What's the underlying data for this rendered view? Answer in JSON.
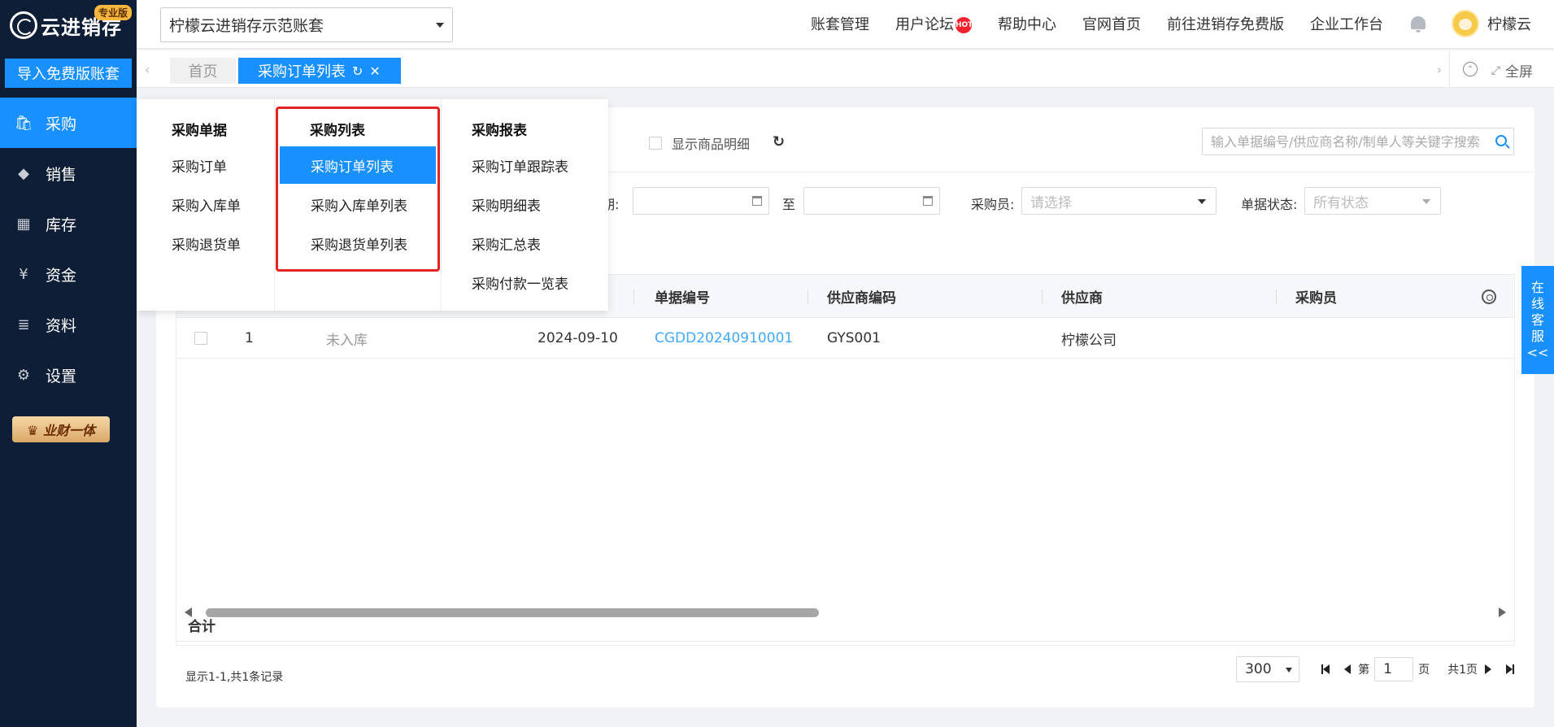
{
  "sidebar": {
    "logo_text": "云进销存",
    "pro_badge": "专业版",
    "import_button": "导入免费版账套",
    "items": [
      {
        "label": "采购",
        "icon": "shopping-bag-icon",
        "glyph": "🛍"
      },
      {
        "label": "销售",
        "icon": "sales-icon",
        "glyph": "◆"
      },
      {
        "label": "库存",
        "icon": "warehouse-icon",
        "glyph": "▦"
      },
      {
        "label": "资金",
        "icon": "yen-icon",
        "glyph": "¥"
      },
      {
        "label": "资料",
        "icon": "document-icon",
        "glyph": "≣"
      },
      {
        "label": "设置",
        "icon": "gear-icon",
        "glyph": "⚙"
      }
    ],
    "promo": "♛ 业财一体"
  },
  "header": {
    "account_name": "柠檬云进销存示范账套",
    "links": [
      "账套管理",
      "用户论坛",
      "帮助中心",
      "官网首页",
      "前往进销存免费版",
      "企业工作台"
    ],
    "hot_badge": "HOT",
    "user_name": "柠檬云"
  },
  "tabs": {
    "home": "首页",
    "active": "采购订单列表",
    "fullscreen": "全屏"
  },
  "filters": {
    "show_detail": "显示商品明细",
    "search_placeholder": "输入单据编号/供应商名称/制单人等关键字搜索",
    "date_label_tail": "期:",
    "to_label": "至",
    "buyer_label": "采购员:",
    "buyer_placeholder": "请选择",
    "status_label": "单据状态:",
    "status_value": "所有状态"
  },
  "grid": {
    "columns": [
      "单据编号",
      "供应商编码",
      "供应商",
      "采购员"
    ],
    "rows": [
      {
        "index": "1",
        "status": "未入库",
        "date": "2024-09-10",
        "bill_no": "CGDD20240910001",
        "supplier_code": "GYS001",
        "supplier": "柠檬公司",
        "buyer": ""
      }
    ],
    "total_label": "合计"
  },
  "pager": {
    "info": "显示1-1,共1条记录",
    "page_size": "300",
    "page_prefix": "第",
    "current_page": "1",
    "page_suffix": "页",
    "total_pages": "共1页"
  },
  "mega_menu": {
    "columns": [
      {
        "title": "采购单据",
        "items": [
          "采购订单",
          "采购入库单",
          "采购退货单"
        ]
      },
      {
        "title": "采购列表",
        "items": [
          "采购订单列表",
          "采购入库单列表",
          "采购退货单列表"
        ]
      },
      {
        "title": "采购报表",
        "items": [
          "采购订单跟踪表",
          "采购明细表",
          "采购汇总表",
          "采购付款一览表"
        ]
      }
    ],
    "selected": "采购订单列表"
  },
  "online_service": [
    "在",
    "线",
    "客",
    "服",
    "<<"
  ],
  "colors": {
    "sidebar_bg": "#0d1e36",
    "accent": "#1890ff",
    "highlight": "#e62222",
    "link": "#40a9ff"
  }
}
